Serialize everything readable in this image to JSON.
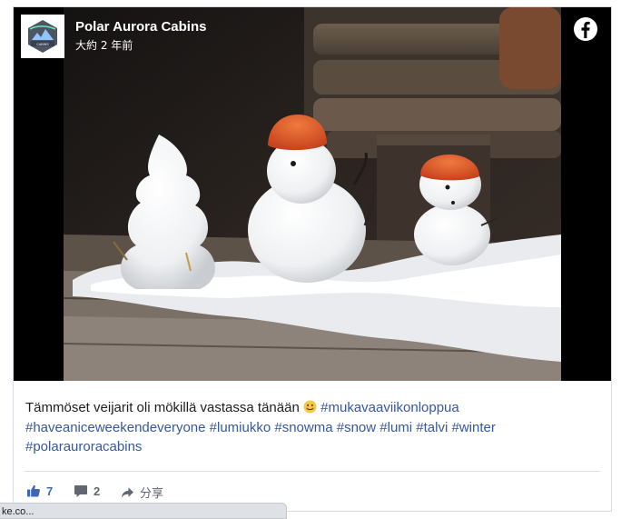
{
  "post": {
    "page_name": "Polar Aurora Cabins",
    "timestamp": "大約 2 年前",
    "logo_text": "POLAR AURORA CABINS",
    "caption_text": "Tämmöset veijarit oli mökillä vastassa tänään",
    "hashtags": [
      "#mukavaaviikonloppua",
      "#haveaniceweekendeveryone",
      "#lumiukko",
      "#snowma",
      "#snow",
      "#lumi",
      "#talvi",
      "#winter",
      "#polarauroracabins"
    ]
  },
  "actions": {
    "likes": "7",
    "comments": "2",
    "share_label": "分享"
  },
  "status_bar": {
    "text": "ke.co..."
  },
  "colors": {
    "link": "#385898",
    "like": "#4267b2",
    "snowman_hat": "#e0542a"
  },
  "icons": [
    "facebook-icon",
    "like-icon",
    "comment-icon",
    "share-icon",
    "smile-emoji-icon"
  ]
}
